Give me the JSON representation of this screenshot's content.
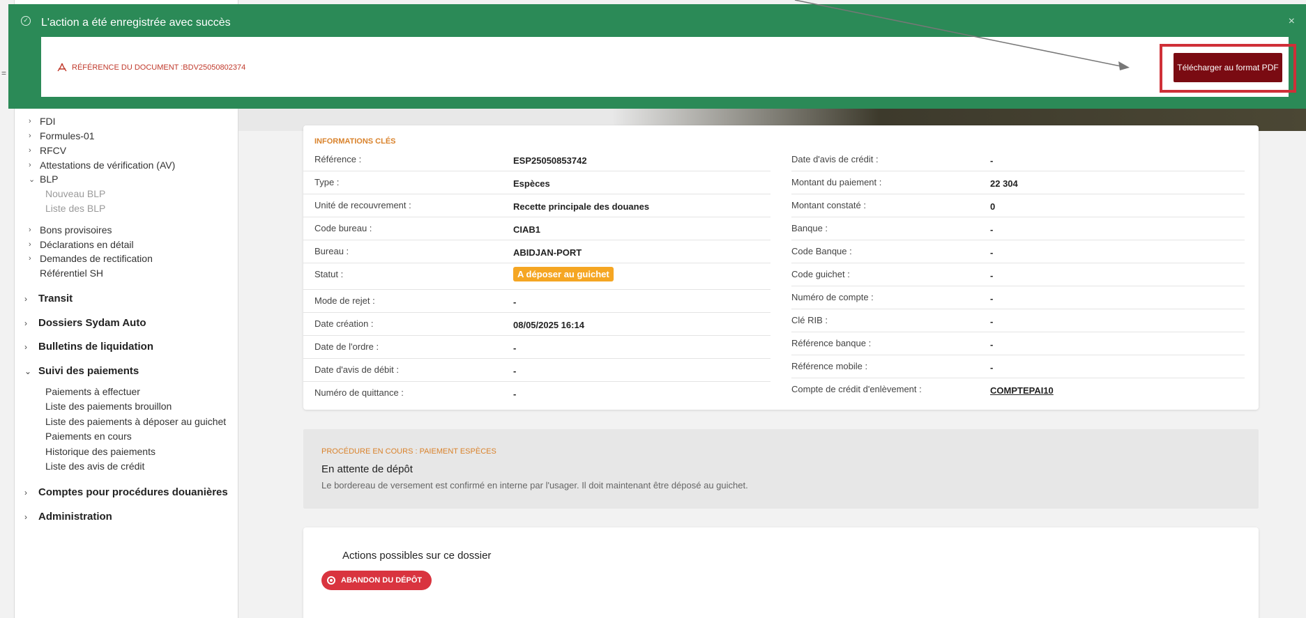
{
  "toast": {
    "message": "L'action a été enregistrée avec succès",
    "document_reference": "RÉFÉRENCE DU DOCUMENT :BDV25050802374",
    "download_label": "Télécharger au format PDF",
    "close_glyph": "×"
  },
  "sidebar": {
    "sub_items": [
      {
        "label": "FDI",
        "chevron": "›"
      },
      {
        "label": "Formules-01",
        "chevron": "›"
      },
      {
        "label": "RFCV",
        "chevron": "›"
      },
      {
        "label": "Attestations de vérification (AV)",
        "chevron": "›"
      },
      {
        "label": "BLP",
        "chevron": "⌄"
      }
    ],
    "blp_children": [
      "Nouveau BLP",
      "Liste des BLP"
    ],
    "sub_items_2": [
      {
        "label": "Bons provisoires",
        "chevron": "›"
      },
      {
        "label": "Déclarations en détail",
        "chevron": "›"
      },
      {
        "label": "Demandes de rectification",
        "chevron": "›"
      },
      {
        "label": "Référentiel SH",
        "chevron": ""
      }
    ],
    "sections": [
      {
        "label": "Transit",
        "chevron": "›"
      },
      {
        "label": "Dossiers Sydam Auto",
        "chevron": "›"
      },
      {
        "label": "Bulletins de liquidation",
        "chevron": "›"
      },
      {
        "label": "Suivi des paiements",
        "chevron": "⌄"
      }
    ],
    "payments_children": [
      "Paiements à effectuer",
      "Liste des paiements brouillon",
      "Liste des paiements à déposer au guichet",
      "Paiements en cours",
      "Historique des paiements",
      "Liste des avis de crédit"
    ],
    "sections_2": [
      {
        "label": "Comptes pour procédures douanières",
        "chevron": "›"
      },
      {
        "label": "Administration",
        "chevron": "›"
      }
    ]
  },
  "key_info": {
    "title": "INFORMATIONS CLÉS",
    "left": [
      {
        "label": "Référence :",
        "value": "ESP25050853742"
      },
      {
        "label": "Type :",
        "value": "Espèces"
      },
      {
        "label": "Unité de recouvrement :",
        "value": "Recette principale des douanes"
      },
      {
        "label": "Code bureau :",
        "value": "CIAB1"
      },
      {
        "label": "Bureau :",
        "value": "ABIDJAN-PORT"
      },
      {
        "label": "Statut :",
        "value": "A déposer au guichet"
      },
      {
        "label": "Mode de rejet :",
        "value": "-"
      },
      {
        "label": "Date création :",
        "value": "08/05/2025 16:14"
      },
      {
        "label": "Date de l'ordre :",
        "value": "-"
      },
      {
        "label": "Date d'avis de débit :",
        "value": "-"
      },
      {
        "label": "Numéro de quittance :",
        "value": "-"
      }
    ],
    "right": [
      {
        "label": "Date d'avis de crédit :",
        "value": "-"
      },
      {
        "label": "Montant du paiement :",
        "value": "22 304"
      },
      {
        "label": "Montant constaté :",
        "value": "0"
      },
      {
        "label": "Banque :",
        "value": "-"
      },
      {
        "label": "Code Banque :",
        "value": "-"
      },
      {
        "label": "Code guichet :",
        "value": "-"
      },
      {
        "label": "Numéro de compte :",
        "value": "-"
      },
      {
        "label": "Clé RIB :",
        "value": "-"
      },
      {
        "label": "Référence banque :",
        "value": "-"
      },
      {
        "label": "Référence mobile :",
        "value": "-"
      },
      {
        "label": "Compte de crédit d'enlèvement :",
        "value": "COMPTEPAI10"
      }
    ],
    "status_color": "#f5a623"
  },
  "procedure": {
    "title": "PROCÉDURE EN COURS : PAIEMENT ESPÈCES",
    "heading": "En attente de dépôt",
    "description": "Le bordereau de versement est confirmé en interne par l'usager. Il doit maintenant être déposé au guichet."
  },
  "actions": {
    "heading": "Actions possibles sur ce dossier",
    "abandon_label": "ABANDON DU DÉPÔT"
  },
  "colors": {
    "toast_green": "#2b8a57",
    "pdf_button": "#7a0b12",
    "highlight_red": "#cf3038",
    "accent_orange": "#d9822b"
  }
}
